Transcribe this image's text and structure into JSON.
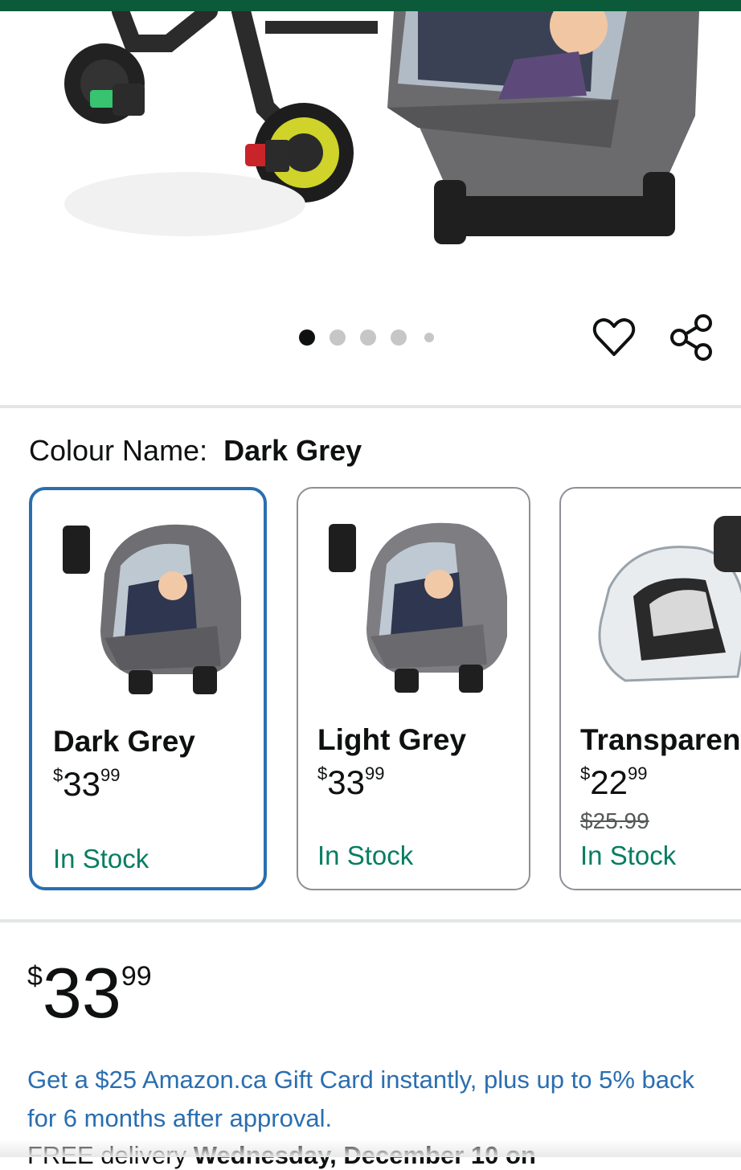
{
  "carousel": {
    "image_count": 5,
    "active_index": 0,
    "favorite_icon": "heart-icon",
    "share_icon": "share-icon"
  },
  "variation": {
    "label": "Colour Name:",
    "selected": "Dark Grey"
  },
  "swatches": [
    {
      "name": "Dark Grey",
      "price_symbol": "$",
      "price_whole": "33",
      "price_fraction": "99",
      "stock": "In Stock",
      "selected": true
    },
    {
      "name": "Light Grey",
      "price_symbol": "$",
      "price_whole": "33",
      "price_fraction": "99",
      "stock": "In Stock",
      "selected": false
    },
    {
      "name": "Transparent",
      "price_symbol": "$",
      "price_whole": "22",
      "price_fraction": "99",
      "was_price": "$25.99",
      "stock": "In Stock",
      "selected": false
    }
  ],
  "price": {
    "symbol": "$",
    "whole": "33",
    "fraction": "99"
  },
  "promo": "Get a $25 Amazon.ca Gift Card instantly, plus up to 5% back for 6 months after approval.",
  "delivery": {
    "prefix": "FREE delivery ",
    "date": "Wednesday, December 10 on"
  },
  "colors": {
    "brand_green": "#0b5a3a",
    "link_blue": "#2a6eb0",
    "stock_green": "#067d62",
    "selected_border": "#2a6eb0"
  }
}
